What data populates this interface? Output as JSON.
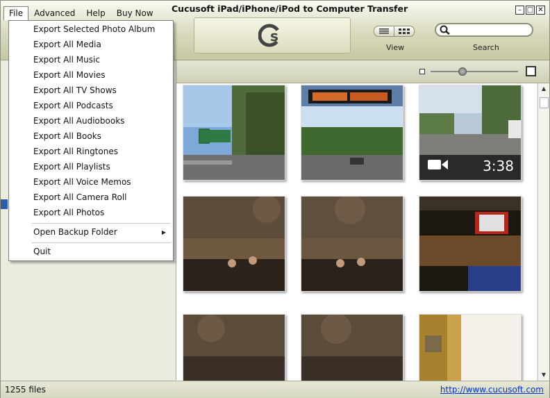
{
  "window": {
    "title": "Cucusoft iPad/iPhone/iPod to Computer Transfer"
  },
  "menubar": {
    "items": [
      "File",
      "Advanced",
      "Help",
      "Buy Now"
    ]
  },
  "toolbar": {
    "view_label": "View",
    "search_label": "Search",
    "search_value": ""
  },
  "file_menu": {
    "export_items": [
      "Export Selected Photo Album",
      "Export All Media",
      "Export All Music",
      "Export All Movies",
      "Export All TV Shows",
      "Export All Podcasts",
      "Export All Audiobooks",
      "Export All Books",
      "Export All Ringtones",
      "Export All Playlists",
      "Export All Voice Memos",
      "Export All Camera Roll",
      "Export All Photos"
    ],
    "open_backup": "Open Backup Folder",
    "quit": "Quit"
  },
  "thumbnails": [
    {
      "duration": ""
    },
    {
      "duration": ""
    },
    {
      "duration": "3:38"
    },
    {
      "duration": ""
    },
    {
      "duration": ""
    },
    {
      "duration": ""
    },
    {
      "duration": ""
    },
    {
      "duration": ""
    },
    {
      "duration": ""
    }
  ],
  "status": {
    "file_count": "1255 files",
    "url": "http://www.cucusoft.com"
  },
  "colors": {
    "url": "#0033cc",
    "toolbar_bg": "#d9dabd"
  }
}
